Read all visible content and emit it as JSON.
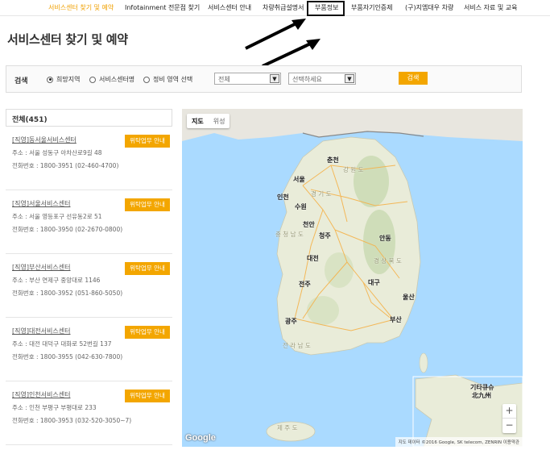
{
  "nav": {
    "items": [
      {
        "label": "서비스센터 찾기 및 예약",
        "active": true
      },
      {
        "label": "Infotainment 전문점 찾기",
        "active": false
      },
      {
        "label": "서비스센터 안내",
        "active": false
      },
      {
        "label": "차량취급설명서",
        "active": false
      },
      {
        "label": "부품정보",
        "active": false,
        "highlighted": true
      },
      {
        "label": "부품자기인증제",
        "active": false
      },
      {
        "label": "(구)지엠대우 차량",
        "active": false
      },
      {
        "label": "서비스 자료 및 교육",
        "active": false
      }
    ]
  },
  "page": {
    "title": "서비스센터 찾기 및 예약"
  },
  "search": {
    "label": "검색",
    "radios": [
      {
        "label": "희망지역",
        "checked": true
      },
      {
        "label": "서비스센터명",
        "checked": false
      },
      {
        "label": "정비 영역 선택",
        "checked": false
      }
    ],
    "select1": "전체",
    "select2": "선택하세요",
    "button": "검색"
  },
  "list": {
    "header": "전체(451)",
    "button_label": "위탁업무 안내",
    "entries": [
      {
        "name": "[직영]동서울서비스센터",
        "addr": "주소 : 서울 성동구 아차산로9길 48",
        "tel": "전화번호 : 1800-3951 (02-460-4700)"
      },
      {
        "name": "[직영]서울서비스센터",
        "addr": "주소 : 서울 영등포구 선유동2로 51",
        "tel": "전화번호 : 1800-3950 (02-2670-0800)"
      },
      {
        "name": "[직영]부산서비스센터",
        "addr": "주소 : 부산 연제구 중앙대로 1146",
        "tel": "전화번호 : 1800-3952 (051-860-5050)"
      },
      {
        "name": "[직영]대전서비스센터",
        "addr": "주소 : 대전 대덕구 대화로 52번길 137",
        "tel": "전화번호 : 1800-3955 (042-630-7800)"
      },
      {
        "name": "[직영]인천서비스센터",
        "addr": "주소 : 인천 부평구 부평대로 233",
        "tel": "전화번호 : 1800-3953 (032-520-3050~7)"
      }
    ]
  },
  "map": {
    "type_map": "지도",
    "type_sat": "위성",
    "zoom_in": "+",
    "zoom_out": "−",
    "logo": "Google",
    "attribution": "지도 데이터 ©2016 Google, SK telecom, ZENRIN   이용약관",
    "labels": {
      "chuncheon": "춘천",
      "gangwon": "강 원 도",
      "seoul": "서울",
      "incheon": "인천",
      "gyeonggi": "경 기 도",
      "suwon": "수원",
      "cheonan": "천안",
      "chungnam": "충 청 남 도",
      "cheongju": "청주",
      "daejeon": "대전",
      "andong": "안동",
      "gyeongbuk": "경 상 북 도",
      "daegu": "대구",
      "jeonju": "전주",
      "gwangju": "광주",
      "jeonnam": "전 라 남 도",
      "busan": "부산",
      "jeju": "제 주 도",
      "kitakyushu": "기타큐슈",
      "kitakyushu_kanji": "北九州",
      "ulsan": "울산"
    }
  }
}
